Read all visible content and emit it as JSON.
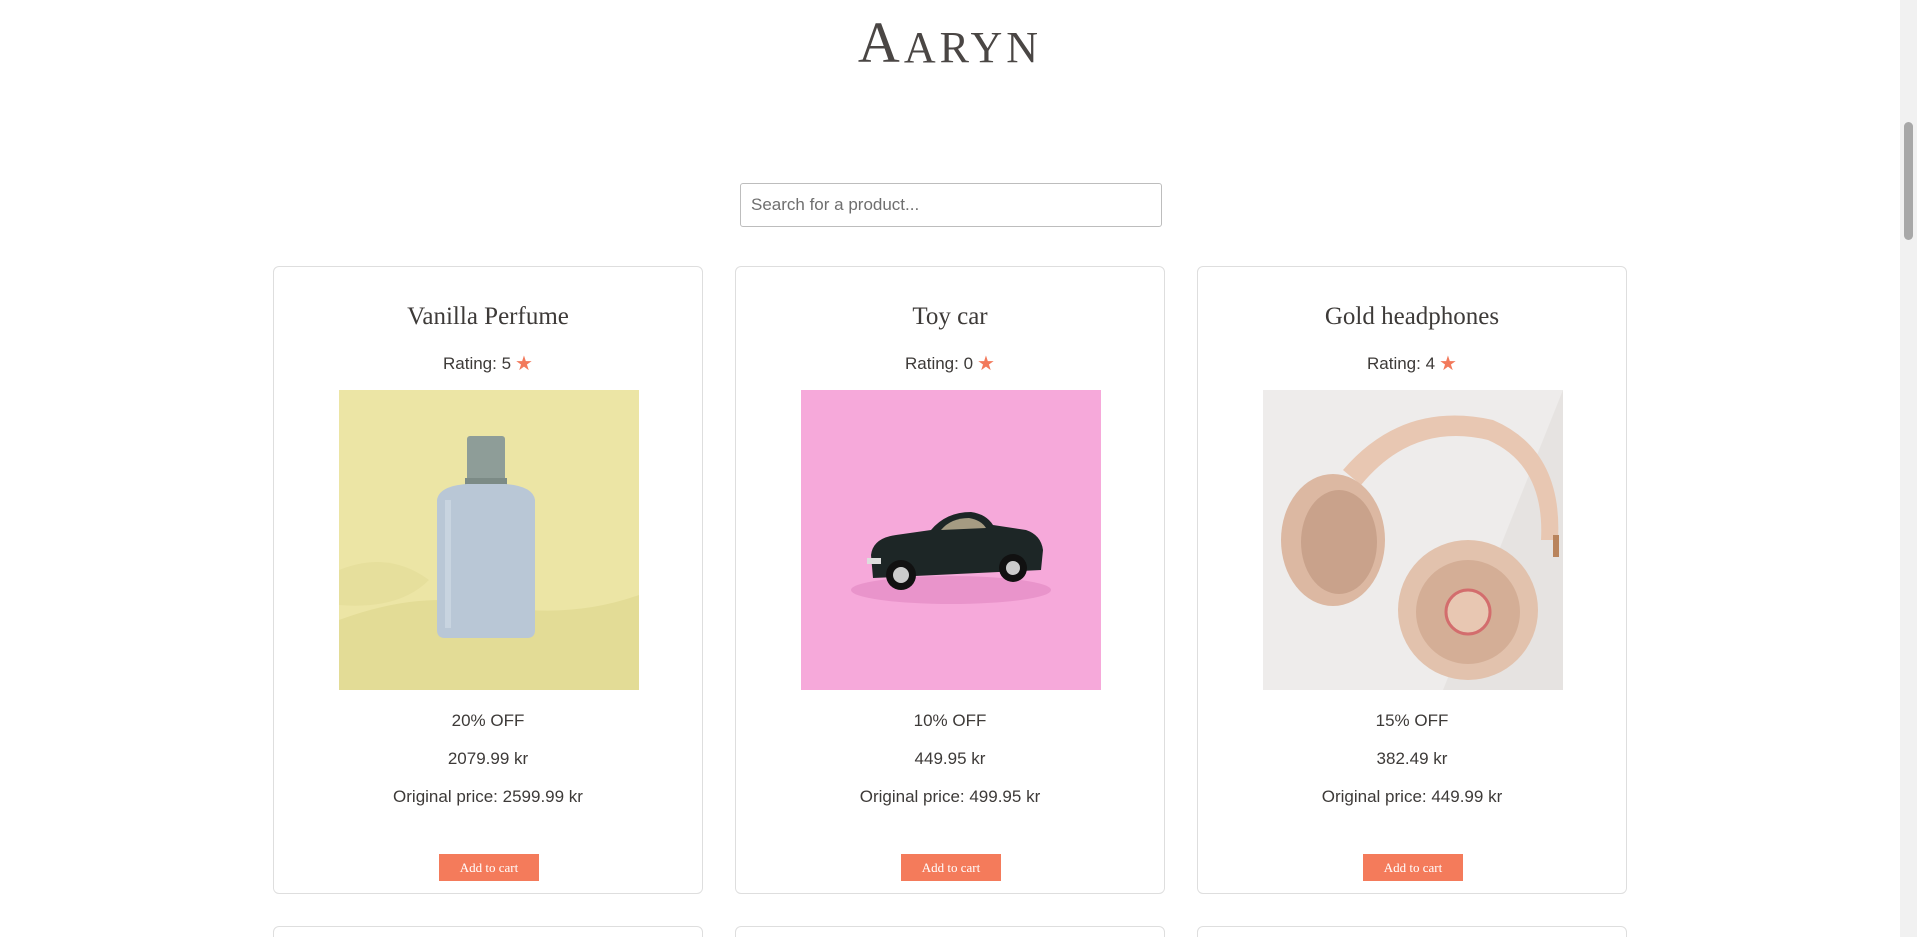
{
  "brand": {
    "first_letter": "A",
    "rest": "ARYN"
  },
  "search": {
    "placeholder": "Search for a product..."
  },
  "products": [
    {
      "title": "Vanilla Perfume",
      "rating": "Rating: 5",
      "discount": "20% OFF",
      "price": "2079.99 kr",
      "original": "Original price: 2599.99 kr",
      "button": "Add to cart",
      "image": "perfume-bottle"
    },
    {
      "title": "Toy car",
      "rating": "Rating: 0",
      "discount": "10% OFF",
      "price": "449.95 kr",
      "original": "Original price: 499.95 kr",
      "button": "Add to cart",
      "image": "toy-car"
    },
    {
      "title": "Gold headphones",
      "rating": "Rating: 4",
      "discount": "15% OFF",
      "price": "382.49 kr",
      "original": "Original price: 449.99 kr",
      "button": "Add to cart",
      "image": "headphones"
    }
  ],
  "colors": {
    "accent": "#f47b5b",
    "text": "#3d3a38",
    "border": "#dedede"
  },
  "icons": {
    "rating": "star-icon"
  }
}
